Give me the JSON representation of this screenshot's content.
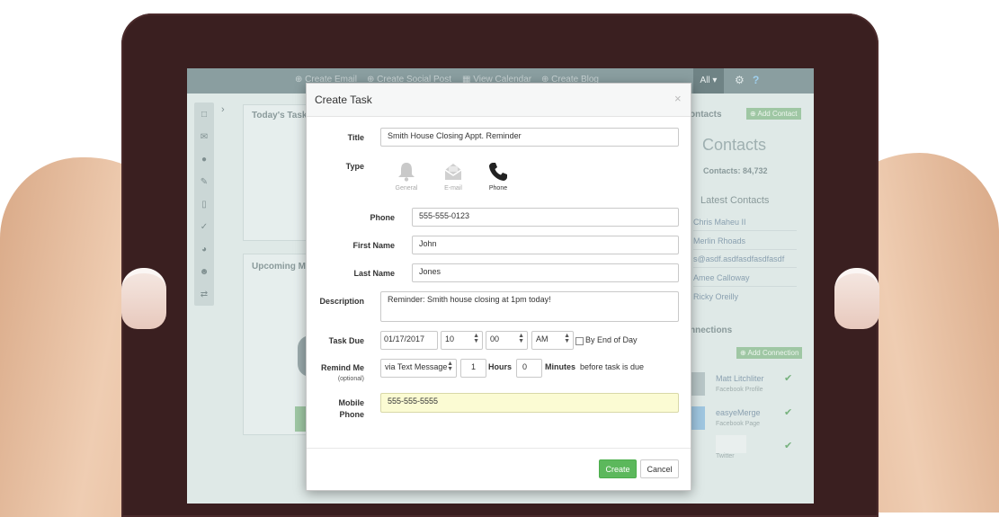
{
  "app_bar": {
    "items": [
      "Create Email",
      "Create Social Post",
      "View Calendar",
      "Create Blog"
    ],
    "filter": "All"
  },
  "background": {
    "todays_tasks": "Today's Tasks",
    "upcoming": "Upcoming Ma",
    "contacts_tab": "ontacts",
    "add_contact": "Add Contact",
    "contacts_title": "Contacts",
    "contacts_count": "Contacts: 84,732",
    "latest_contacts": "Latest Contacts",
    "latest_list": [
      "Chris Maheu II",
      "Merlin Rhoads",
      "s@asdf.asdfasdfasdfasdf",
      "Amee Calloway",
      "Ricky Oreilly"
    ],
    "connections_tab": "nnections",
    "add_connection": "Add Connection",
    "connections": [
      {
        "name": "Matt Litchliter",
        "sub": "Facebook Profile"
      },
      {
        "name": "easyeMerge",
        "sub": "Facebook Page"
      },
      {
        "name": "",
        "sub": "Twitter"
      }
    ]
  },
  "modal": {
    "title": "Create Task",
    "labels": {
      "title": "Title",
      "type": "Type",
      "phone": "Phone",
      "first_name": "First Name",
      "last_name": "Last Name",
      "description": "Description",
      "task_due": "Task Due",
      "remind_me": "Remind Me",
      "optional": "(optional)",
      "mobile": "Mobile",
      "mobile_phone": "Phone"
    },
    "values": {
      "title": "Smith House Closing Appt. Reminder",
      "phone": "555-555-0123",
      "first_name": "John",
      "last_name": "Jones",
      "description": "Reminder: Smith house closing at 1pm today!",
      "due_date": "01/17/2017",
      "due_hour": "10",
      "due_minute": "00",
      "due_ampm": "AM",
      "end_of_day": "By End of Day",
      "remind_via": "via Text Message",
      "remind_hours": "1",
      "hours_label": "Hours",
      "remind_minutes": "0",
      "minutes_label": "Minutes",
      "before_due": "before task is due",
      "mobile_phone": "555-555-5555"
    },
    "types": [
      {
        "label": "General",
        "icon": "bell-icon",
        "selected": false
      },
      {
        "label": "E-mail",
        "icon": "envelope-icon",
        "selected": false
      },
      {
        "label": "Phone",
        "icon": "phone-icon",
        "selected": true
      }
    ],
    "buttons": {
      "create": "Create",
      "cancel": "Cancel"
    }
  },
  "colors": {
    "create_button": "#5cb85c",
    "mobile_highlight": "#fbfbd3",
    "bezel": "#3a1f20"
  }
}
